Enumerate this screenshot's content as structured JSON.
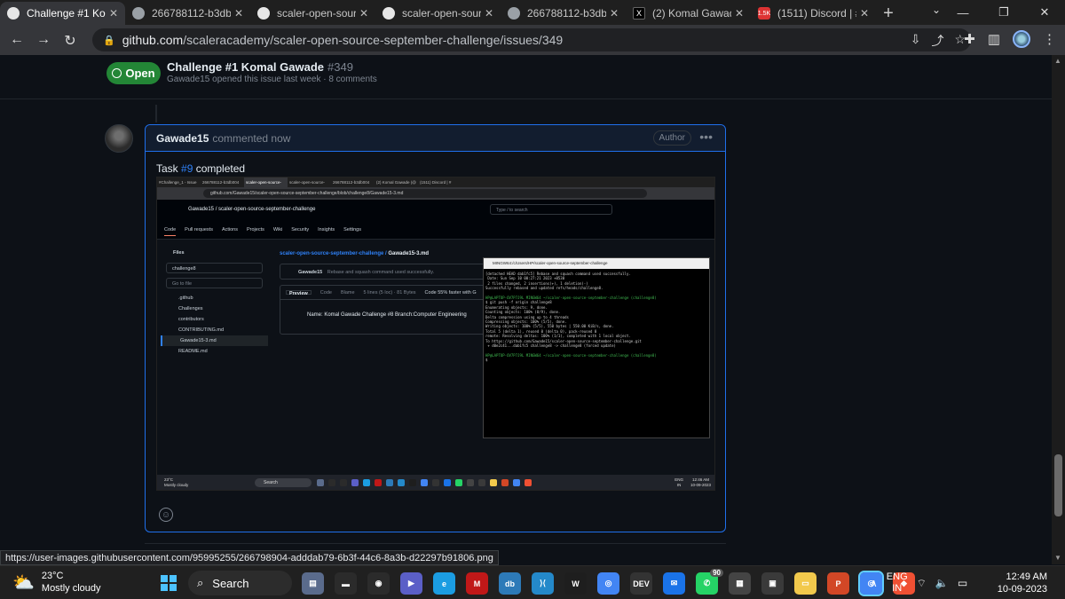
{
  "browser": {
    "tabs": [
      {
        "label": "Challenge #1 Komal G",
        "icon": "github",
        "active": true
      },
      {
        "label": "266788112-b3db004",
        "icon": "image"
      },
      {
        "label": "scaler-open-source-s",
        "icon": "github"
      },
      {
        "label": "scaler-open-source-s",
        "icon": "github"
      },
      {
        "label": "266788112-b3db004",
        "icon": "image"
      },
      {
        "label": "(2) Komal Gawade (@",
        "icon": "x"
      },
      {
        "label": "(1511) Discord | #",
        "icon": "discord",
        "badge": "1.5K"
      }
    ],
    "url_host": "github.com",
    "url_path": "/scaleracademy/scaler-open-source-september-challenge/issues/349",
    "status_link": "https://user-images.githubusercontent.com/95995255/266798904-adddab79-6b3f-44c6-8a3b-d22297b91806.png"
  },
  "issue": {
    "state": "Open",
    "title": "Challenge #1 Komal Gawade",
    "number": "#349",
    "meta": "Gawade15 opened this issue last week · 8 comments"
  },
  "comment": {
    "author": "Gawade15",
    "time": "commented now",
    "badge": "Author",
    "body_prefix": "Task ",
    "body_link": "#9",
    "body_suffix": " completed"
  },
  "screenshot": {
    "tabs": [
      "#Challenge_1 - Issue",
      "266788112-b3db004",
      "scaler-open-source-",
      "scaler-open-source-",
      "266788112-b3db004",
      "(2) Komal Gawade (@",
      "(1511) Discord | #"
    ],
    "url": "github.com/Gawade15/scaler-open-source-september-challenge/blob/challenge8/Gawade15-3.md",
    "repo": "Gawade15 / scaler-open-source-september-challenge",
    "search": "Type / to search",
    "nav": [
      "Code",
      "Pull requests",
      "Actions",
      "Projects",
      "Wiki",
      "Security",
      "Insights",
      "Settings"
    ],
    "files_title": "Files",
    "branch": "challenge8",
    "goto": "Go to file",
    "tree": [
      ".github",
      "Challenges",
      "contributors",
      "CONTRIBUTING.md",
      "Gawade15-3.md",
      "README.md"
    ],
    "breadcrumb_repo": "scaler-open-source-september-challenge",
    "breadcrumb_file": "Gawade15-3.md",
    "commit_author": "Gawade15",
    "commit_msg": "Rebase and squash command used successfully.",
    "viewer_tabs": [
      "Preview",
      "Code",
      "Blame"
    ],
    "viewer_meta": "5 lines (5 loc) · 81 Bytes",
    "viewer_note": "Code 55% faster with G",
    "content": "Name: Komal Gawade Challenge #8 Branch:Computer Engineering",
    "terminal_title": "MINGW64:/c/Users/HP/scaler-open-source-september-challenge",
    "terminal_lines": [
      "[detached HEAD dab1fc5] Rebase and squash command used successfully.",
      " Date: Sun Sep 10 00:27:21 2023 +0530",
      " 2 files changed, 2 insertions(+), 1 deletion(-)",
      "Successfully rebased and updated refs/heads/challenge8.",
      "",
      "HP@LAPTOP-OV7P7J9L MINGW64 ~/scaler-open-source-september-challenge (challenge8)",
      "$ git push -f origin challenge8",
      "Enumerating objects: 9, done.",
      "Counting objects: 100% (8/9), done.",
      "Delta compression using up to 4 threads",
      "Compressing objects: 100% (5/5), done.",
      "Writing objects: 100% (5/5), 550 bytes | 550.00 KiB/s, done.",
      "Total 5 (delta 1), reused 0 (delta 0), pack-reused 0",
      "remote: Resolving deltas: 100% (1/1), completed with 1 local object.",
      "To https://github.com/Gawade15/scaler-open-source-september-challenge.git",
      " + d0e2c41...dab1fc5 challenge8 -> challenge8 (forced update)",
      "",
      "HP@LAPTOP-OV7P7J9L MINGW64 ~/scaler-open-source-september-challenge (challenge8)",
      "$"
    ],
    "taskbar_temp": "23°C",
    "taskbar_weather": "Mostly cloudy",
    "taskbar_search": "Search",
    "taskbar_lang": "ENG",
    "taskbar_region": "IN",
    "taskbar_time": "12:46 AM",
    "taskbar_date": "10-09-2023"
  },
  "taskbar": {
    "temp": "23°C",
    "weather": "Mostly cloudy",
    "search": "Search",
    "whatsapp_badge": "90",
    "lang": "ENG",
    "region": "IN",
    "time": "12:49 AM",
    "date": "10-09-2023",
    "app_icons": [
      {
        "name": "files",
        "color": "#5a6b8c"
      },
      {
        "name": "folder",
        "color": "#2b2b2b"
      },
      {
        "name": "camera",
        "color": "#2b2b2b"
      },
      {
        "name": "zoom",
        "color": "#5b5fc7"
      },
      {
        "name": "edge",
        "color": "#1b9de2"
      },
      {
        "name": "mcafee",
        "color": "#c01818"
      },
      {
        "name": "mysql",
        "color": "#2d7ab8"
      },
      {
        "name": "vscode",
        "color": "#2489ca"
      },
      {
        "name": "wps",
        "color": "#1e1e1e"
      },
      {
        "name": "chrome",
        "color": "#4285f4"
      },
      {
        "name": "dev",
        "color": "#333333"
      },
      {
        "name": "mail",
        "color": "#1a73e8"
      },
      {
        "name": "whatsapp",
        "color": "#25d366"
      },
      {
        "name": "sticky",
        "color": "#444444"
      },
      {
        "name": "ms-store",
        "color": "#3a3a3a"
      },
      {
        "name": "explorer",
        "color": "#f2c94c"
      },
      {
        "name": "powerpoint",
        "color": "#d24726"
      },
      {
        "name": "chrome-active",
        "color": "#4285f4"
      },
      {
        "name": "git",
        "color": "#f05033"
      }
    ]
  }
}
